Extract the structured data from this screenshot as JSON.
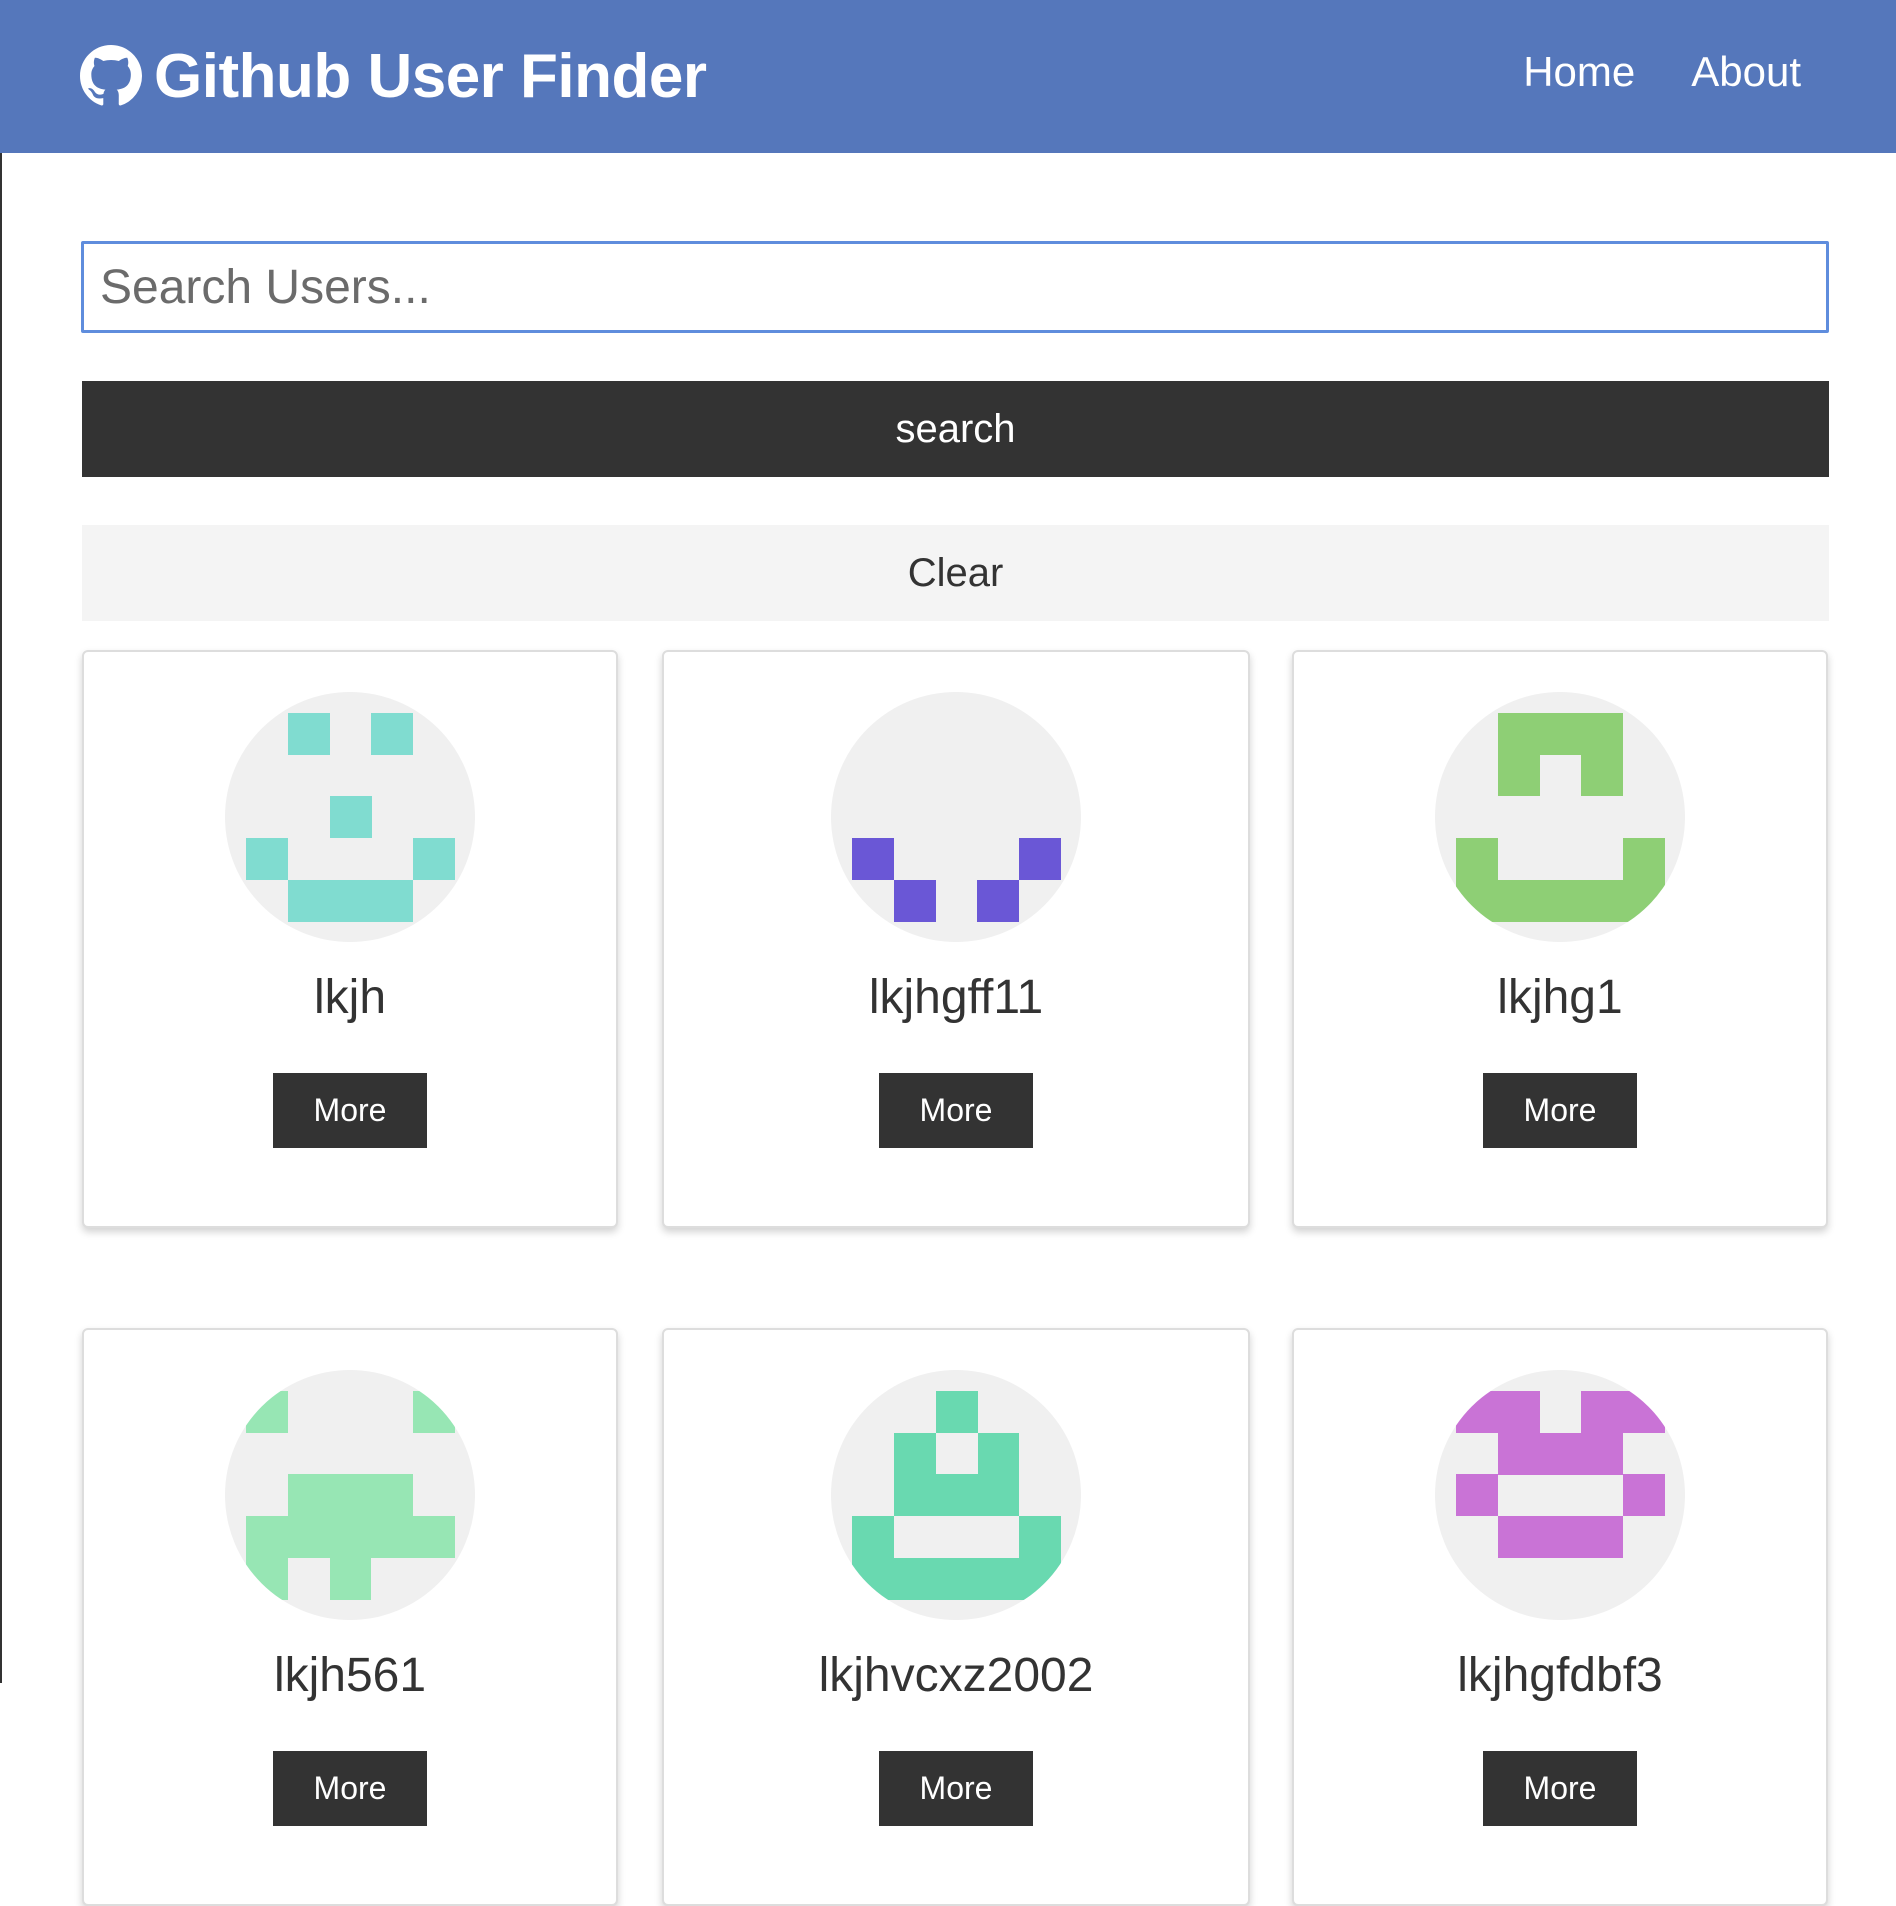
{
  "navbar": {
    "brand_icon": "github-icon",
    "title": "Github User Finder",
    "links": [
      "Home",
      "About"
    ]
  },
  "search": {
    "placeholder": "Search Users...",
    "value": "",
    "search_label": "search",
    "clear_label": "Clear"
  },
  "users": [
    {
      "login": "lkjh",
      "more_label": "More",
      "avatar_color": "#80dcd0"
    },
    {
      "login": "lkjhgff11",
      "more_label": "More",
      "avatar_color": "#6a57d6"
    },
    {
      "login": "lkjhg1",
      "more_label": "More",
      "avatar_color": "#8ecf75"
    },
    {
      "login": "lkjh561",
      "more_label": "More",
      "avatar_color": "#97e6b4"
    },
    {
      "login": "lkjhvcxz2002",
      "more_label": "More",
      "avatar_color": "#69d9b0"
    },
    {
      "login": "lkjhgfdbf3",
      "more_label": "More",
      "avatar_color": "#c973d6"
    }
  ],
  "colors": {
    "navbar": "#5577bb",
    "dark": "#333333",
    "light": "#f4f4f4",
    "input_focus": "#5f8ddd",
    "avatar_bg": "#f0f0f0"
  }
}
